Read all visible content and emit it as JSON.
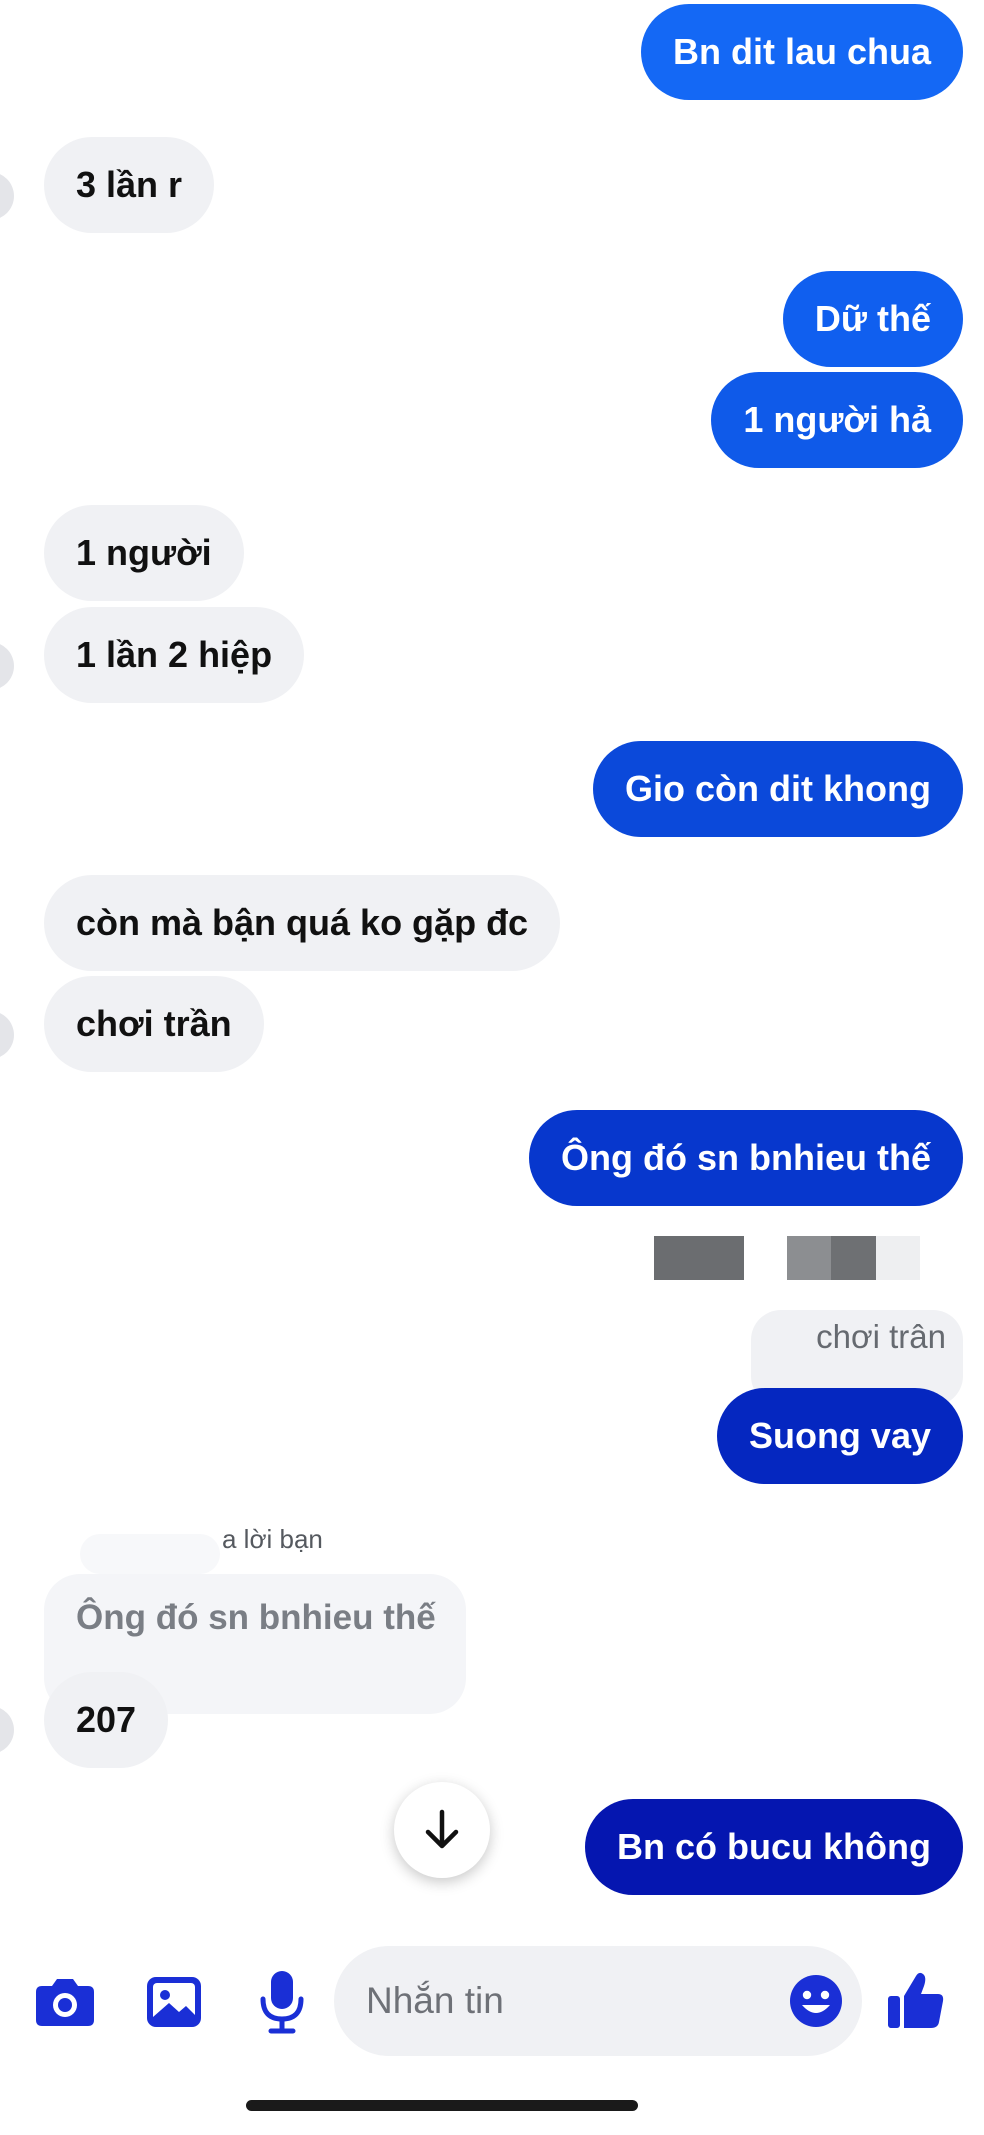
{
  "messages": [
    {
      "text": "Bn dit lau chua",
      "side": "out",
      "color": "#1468f5"
    },
    {
      "text": "3 lần r",
      "side": "in"
    },
    {
      "text": "Dữ thế",
      "side": "out",
      "color": "#105fef"
    },
    {
      "text": "1 người hả",
      "side": "out",
      "color": "#0f5ae9"
    },
    {
      "text": "1 người",
      "side": "in"
    },
    {
      "text": "1 lần 2 hiệp",
      "side": "in"
    },
    {
      "text": "Gio còn dit khong",
      "side": "out",
      "color": "#0b49da"
    },
    {
      "text": "còn mà bận quá ko gặp đc",
      "side": "in"
    },
    {
      "text": "chơi trần",
      "side": "in"
    },
    {
      "text": "Ông đó sn bnhieu thế",
      "side": "out",
      "color": "#0737cd"
    },
    {
      "text": "Suong vay",
      "side": "out",
      "color": "#0527c0"
    },
    {
      "text": "207",
      "side": "in"
    },
    {
      "text": "Bn có bucu không",
      "side": "out",
      "color": "#0516b0"
    }
  ],
  "quoted_out": {
    "text": "chơi trân"
  },
  "reply": {
    "label": "a lời bạn",
    "quoted_text": "Ông đó sn bnhieu thế"
  },
  "composer": {
    "placeholder": "Nhắn tin",
    "accent": "#1a2fd6",
    "icons": [
      "camera-icon",
      "image-icon",
      "microphone-icon",
      "emoji-icon",
      "thumbs-up-icon"
    ]
  },
  "scroll_button": {
    "icon": "arrow-down-icon"
  }
}
